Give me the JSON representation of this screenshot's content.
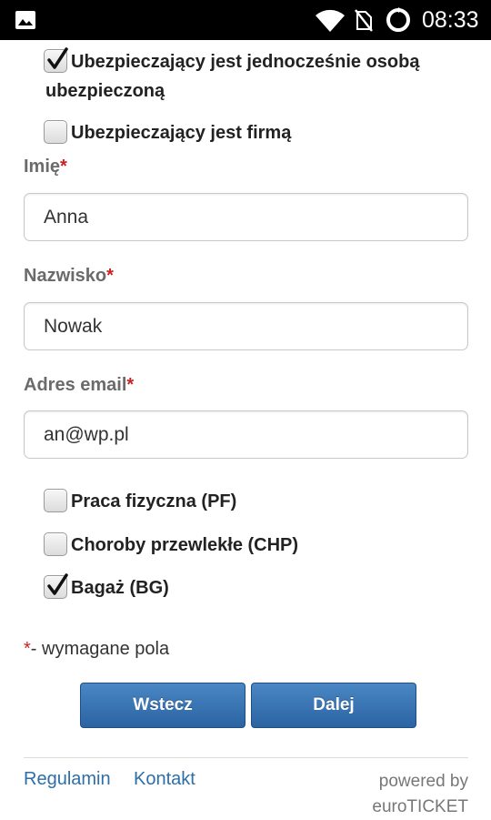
{
  "status_bar": {
    "time": "08:33",
    "icons": [
      "image-icon",
      "wifi-icon",
      "no-sim-icon",
      "sync-icon"
    ]
  },
  "options_top": [
    {
      "label_line1": "Ubezpieczający jest jednocześnie osobą",
      "label_line2": "ubezpieczoną",
      "checked": true
    },
    {
      "label": "Ubezpieczający jest firmą",
      "checked": false
    }
  ],
  "fields": [
    {
      "label": "Imię",
      "required_mark": "*",
      "value": "Anna"
    },
    {
      "label": "Nazwisko",
      "required_mark": "*",
      "value": "Nowak"
    },
    {
      "label": "Adres email",
      "required_mark": "*",
      "value": "an@wp.pl"
    }
  ],
  "extras": [
    {
      "label": "Praca fizyczna (PF)",
      "checked": false
    },
    {
      "label": "Choroby przewlekłe (CHP)",
      "checked": false
    },
    {
      "label": "Bagaż (BG)",
      "checked": true
    }
  ],
  "required_note": {
    "mark": "*",
    "text": "- wymagane pola"
  },
  "buttons": {
    "back": "Wstecz",
    "next": "Dalej"
  },
  "footer": {
    "link_terms": "Regulamin",
    "link_contact": "Kontakt",
    "powered_line1": "powered by",
    "powered_line2": "euroTICKET"
  },
  "colors": {
    "accent": "#2b63a3",
    "link": "#2e6ea8",
    "required": "#cc1f1f"
  }
}
